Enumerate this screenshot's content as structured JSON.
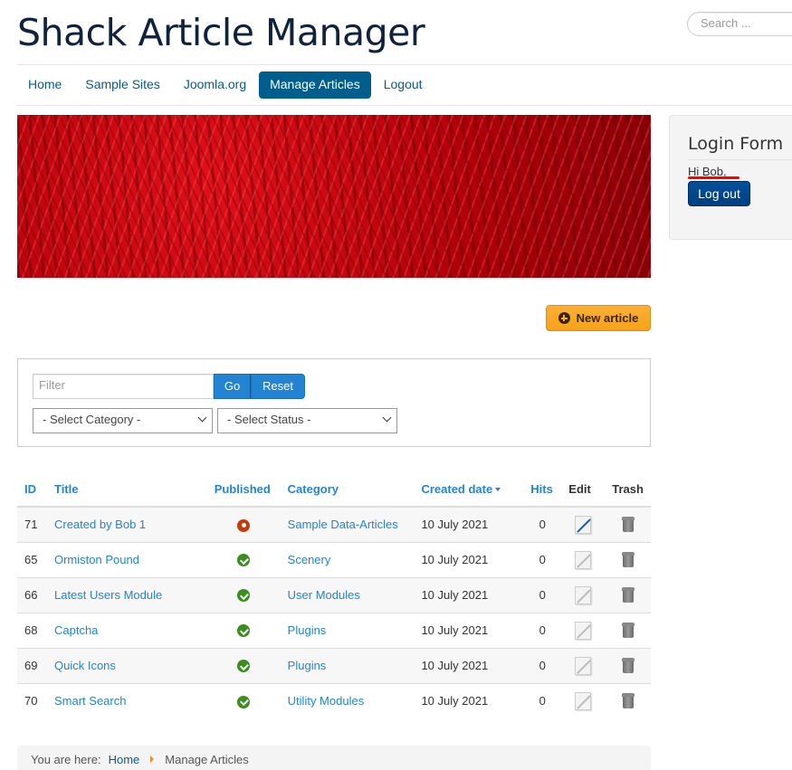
{
  "header": {
    "site_title": "Shack Article Manager",
    "search_placeholder": "Search ..."
  },
  "nav": {
    "items": [
      {
        "label": "Home",
        "active": false
      },
      {
        "label": "Sample Sites",
        "active": false
      },
      {
        "label": "Joomla.org",
        "active": false
      },
      {
        "label": "Manage Articles",
        "active": true
      },
      {
        "label": "Logout",
        "active": false
      }
    ]
  },
  "sidebar": {
    "title": "Login Form",
    "greeting": "Hi Bob,",
    "logout_label": "Log out"
  },
  "toolbar": {
    "new_article_label": "New article"
  },
  "filters": {
    "filter_placeholder": "Filter",
    "go_label": "Go",
    "reset_label": "Reset",
    "category_select": "- Select Category -",
    "status_select": "- Select Status -"
  },
  "table": {
    "headers": {
      "id": "ID",
      "title": "Title",
      "published": "Published",
      "category": "Category",
      "created_date": "Created date",
      "hits": "Hits",
      "edit": "Edit",
      "trash": "Trash"
    },
    "rows": [
      {
        "id": "71",
        "title": "Created by Bob 1",
        "published": "unpublished",
        "category": "Sample Data-Articles",
        "created": "10 July 2021",
        "hits": "0",
        "editable": true
      },
      {
        "id": "65",
        "title": "Ormiston Pound",
        "published": "published",
        "category": "Scenery",
        "created": "10 July 2021",
        "hits": "0",
        "editable": false
      },
      {
        "id": "66",
        "title": "Latest Users Module",
        "published": "published",
        "category": "User Modules",
        "created": "10 July 2021",
        "hits": "0",
        "editable": false
      },
      {
        "id": "68",
        "title": "Captcha",
        "published": "published",
        "category": "Plugins",
        "created": "10 July 2021",
        "hits": "0",
        "editable": false
      },
      {
        "id": "69",
        "title": "Quick Icons",
        "published": "published",
        "category": "Plugins",
        "created": "10 July 2021",
        "hits": "0",
        "editable": false
      },
      {
        "id": "70",
        "title": "Smart Search",
        "published": "published",
        "category": "Utility Modules",
        "created": "10 July 2021",
        "hits": "0",
        "editable": false
      }
    ]
  },
  "breadcrumb": {
    "prefix": "You are here:",
    "home": "Home",
    "current": "Manage Articles"
  },
  "colors": {
    "nav_active": "#005e8d",
    "link": "#2384d3",
    "new_article": "#fbb034",
    "published": "#3a8e1f",
    "unpublished": "#c63b0a"
  }
}
